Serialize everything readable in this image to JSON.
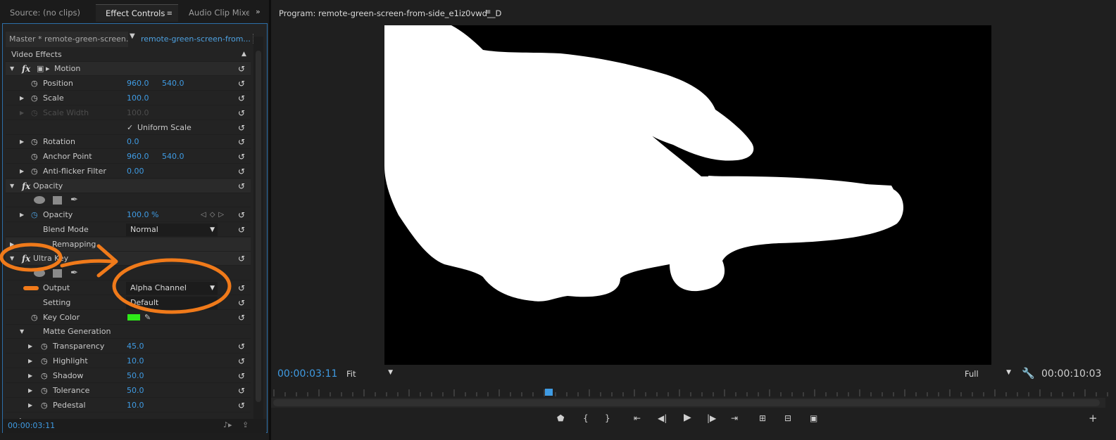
{
  "tabs": {
    "source": "Source: (no clips)",
    "effect_controls": "Effect Controls",
    "audio_mixer": "Audio Clip Mixe",
    "menu_glyph": "≡",
    "overflow_glyph": "»"
  },
  "clip": {
    "master": "Master * remote-green-screen...",
    "sequence_clip": "remote-green-screen-from..."
  },
  "effects": {
    "header": "Video Effects",
    "motion": {
      "name": "Motion",
      "position_label": "Position",
      "position_x": "960.0",
      "position_y": "540.0",
      "scale_label": "Scale",
      "scale_value": "100.0",
      "scale_width_label": "Scale Width",
      "scale_width_value": "100.0",
      "uniform_label": "Uniform Scale",
      "rotation_label": "Rotation",
      "rotation_value": "0.0",
      "anchor_label": "Anchor Point",
      "anchor_x": "960.0",
      "anchor_y": "540.0",
      "antiflicker_label": "Anti-flicker Filter",
      "antiflicker_value": "0.00"
    },
    "opacity": {
      "name": "Opacity",
      "opacity_label": "Opacity",
      "opacity_value": "100.0 %",
      "blend_label": "Blend Mode",
      "blend_value": "Normal"
    },
    "time_remapping_partial": "Remapping",
    "ultra_key": {
      "name": "Ultra Key",
      "output_label": "Output",
      "output_value": "Alpha Channel",
      "setting_label": "Setting",
      "setting_value": "Default",
      "key_color_label": "Key Color",
      "key_color_hex": "#2eea19",
      "matte_label": "Matte Generation",
      "transparency_label": "Transparency",
      "transparency_value": "45.0",
      "highlight_label": "Highlight",
      "highlight_value": "10.0",
      "shadow_label": "Shadow",
      "shadow_value": "50.0",
      "tolerance_label": "Tolerance",
      "tolerance_value": "50.0",
      "pedestal_label": "Pedestal",
      "pedestal_value": "10.0"
    }
  },
  "effect_timecode": "00:00:03:11",
  "program": {
    "title": "Program: remote-green-screen-from-side_e1iz0vwd__D",
    "menu_glyph": "≡",
    "current_timecode": "00:00:03:11",
    "zoom": "Fit",
    "resolution": "Full",
    "duration_timecode": "00:00:10:03",
    "playhead_fraction": 0.33
  },
  "colors": {
    "accent_blue": "#3f9be3",
    "annotation_orange": "#f07a1a",
    "panel_border": "#2d6fa8"
  },
  "icons": {
    "reset": "↺",
    "stopwatch": "◷",
    "twirl_open": "▼",
    "twirl_closed": "▶",
    "checkbox": "✓",
    "eyedropper": "✎",
    "wrench": "🔧"
  }
}
